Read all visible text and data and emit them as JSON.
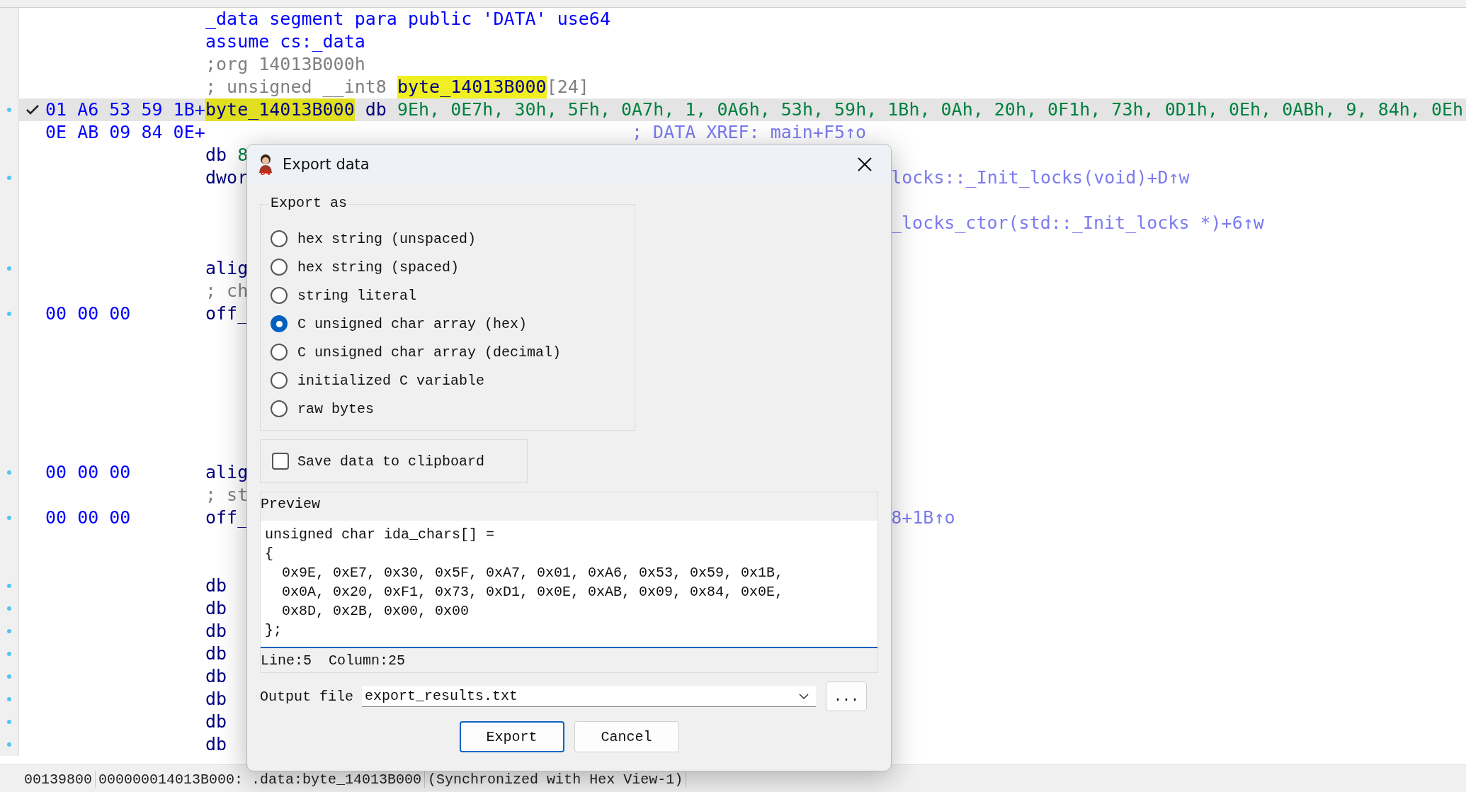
{
  "listing": {
    "rows": [
      {
        "selected": false,
        "dot": false,
        "segments": [
          {
            "kind": "keyword",
            "text": "_data segment para public 'DATA' use64"
          }
        ]
      },
      {
        "selected": false,
        "dot": false,
        "segments": [
          {
            "kind": "keyword",
            "text": "assume cs:_data"
          }
        ]
      },
      {
        "selected": false,
        "dot": false,
        "segments": [
          {
            "kind": "comment",
            "text": ";org 14013B000h"
          }
        ]
      },
      {
        "selected": false,
        "dot": false,
        "segments": [
          {
            "kind": "comment",
            "text": "; unsigned __int8 "
          },
          {
            "kind": "highlight",
            "text": "byte_14013B000"
          },
          {
            "kind": "comment",
            "text": "[24]"
          }
        ]
      },
      {
        "selected": true,
        "dot": true,
        "bytes": "01 A6 53 59 1B+",
        "segments": [
          {
            "kind": "highlight",
            "text": "byte_14013B000"
          },
          {
            "kind": "code",
            "text": " db "
          },
          {
            "kind": "number",
            "text": "9Eh, 0E7h, 30h, 5Fh, 0A7h, 1, 0A6h, 53h, 59h, 1Bh, 0Ah, 20h, 0F1h, 73h, 0D1h, 0Eh, 0ABh, 9, 84h, 0Eh"
          }
        ]
      },
      {
        "selected": false,
        "dot": false,
        "bytes": "0E AB 09 84 0E+",
        "segments": [
          {
            "kind": "xref_near",
            "text": "; DATA XREF: main+F5↑o"
          }
        ]
      },
      {
        "selected": false,
        "dot": false,
        "segments": [
          {
            "kind": "code",
            "text": "db "
          },
          {
            "kind": "number",
            "text": "8"
          }
        ]
      },
      {
        "selected": false,
        "dot": true,
        "segments": [
          {
            "kind": "code",
            "text": "dwor"
          },
          {
            "kind": "xref_tail",
            "text": "locks::_Init_locks(void)+D↑w"
          }
        ]
      },
      {
        "selected": false,
        "dot": false,
        "segments": []
      },
      {
        "selected": false,
        "dot": false,
        "segments": [
          {
            "kind": "xref_tail",
            "text": "_locks_ctor(std::_Init_locks *)+6↑w"
          }
        ]
      },
      {
        "selected": false,
        "dot": false,
        "segments": []
      },
      {
        "selected": false,
        "dot": true,
        "segments": [
          {
            "kind": "code",
            "text": "alig"
          }
        ]
      },
      {
        "selected": false,
        "dot": false,
        "segments": [
          {
            "kind": "comment",
            "text": "; ch"
          }
        ]
      },
      {
        "selected": false,
        "dot": true,
        "bytes": "00 00 00",
        "segments": [
          {
            "kind": "code",
            "text": "off_"
          }
        ]
      },
      {
        "selected": false,
        "dot": false,
        "segments": []
      },
      {
        "selected": false,
        "dot": false,
        "segments": []
      },
      {
        "selected": false,
        "dot": false,
        "segments": []
      },
      {
        "selected": false,
        "dot": false,
        "segments": []
      },
      {
        "selected": false,
        "dot": false,
        "segments": []
      },
      {
        "selected": false,
        "dot": false,
        "segments": []
      },
      {
        "selected": false,
        "dot": true,
        "bytes": "00 00 00",
        "segments": [
          {
            "kind": "code",
            "text": "alig"
          }
        ]
      },
      {
        "selected": false,
        "dot": false,
        "segments": [
          {
            "kind": "comment",
            "text": "; st"
          }
        ]
      },
      {
        "selected": false,
        "dot": true,
        "bytes": "00 00 00",
        "segments": [
          {
            "kind": "code",
            "text": "off_"
          },
          {
            "kind": "xref_tail",
            "text": "8+1B↑o"
          }
        ]
      },
      {
        "selected": false,
        "dot": false,
        "segments": []
      },
      {
        "selected": false,
        "dot": false,
        "segments": []
      },
      {
        "selected": false,
        "dot": true,
        "segments": [
          {
            "kind": "code",
            "text": "db"
          }
        ]
      },
      {
        "selected": false,
        "dot": true,
        "segments": [
          {
            "kind": "code",
            "text": "db"
          }
        ]
      },
      {
        "selected": false,
        "dot": true,
        "segments": [
          {
            "kind": "code",
            "text": "db"
          }
        ]
      },
      {
        "selected": false,
        "dot": true,
        "segments": [
          {
            "kind": "code",
            "text": "db"
          }
        ]
      },
      {
        "selected": false,
        "dot": true,
        "segments": [
          {
            "kind": "code",
            "text": "db"
          }
        ]
      },
      {
        "selected": false,
        "dot": true,
        "segments": [
          {
            "kind": "code",
            "text": "db"
          }
        ]
      },
      {
        "selected": false,
        "dot": true,
        "segments": [
          {
            "kind": "code",
            "text": "db"
          }
        ]
      },
      {
        "selected": false,
        "dot": true,
        "segments": [
          {
            "kind": "code",
            "text": "db"
          }
        ]
      }
    ]
  },
  "status_bar": [
    "00139800",
    "000000014013B000: .data:byte_14013B000",
    "(Synchronized with Hex View-1)"
  ],
  "dialog": {
    "title": "Export data",
    "icon_badge": "64",
    "export_as": {
      "label": "Export as",
      "options": [
        {
          "label": "hex string (unspaced)",
          "selected": false
        },
        {
          "label": "hex string (spaced)",
          "selected": false
        },
        {
          "label": "string literal",
          "selected": false
        },
        {
          "label": "C unsigned char array (hex)",
          "selected": true
        },
        {
          "label": "C unsigned char array (decimal)",
          "selected": false
        },
        {
          "label": "initialized C variable",
          "selected": false
        },
        {
          "label": "raw bytes",
          "selected": false
        }
      ]
    },
    "save_to_clipboard": {
      "label": "Save data to clipboard",
      "checked": false
    },
    "preview": {
      "label": "Preview",
      "lines": [
        "unsigned char ida_chars[] =",
        "{",
        "  0x9E, 0xE7, 0x30, 0x5F, 0xA7, 0x01, 0xA6, 0x53, 0x59, 0x1B,",
        "  0x0A, 0x20, 0xF1, 0x73, 0xD1, 0x0E, 0xAB, 0x09, 0x84, 0x0E,",
        "  0x8D, 0x2B, 0x00, 0x00",
        "};"
      ],
      "position": "Line:5  Column:25"
    },
    "output_file": {
      "label": "Output file",
      "value": "export_results.txt",
      "browse": "..."
    },
    "buttons": [
      {
        "label": "Export",
        "kind": "default"
      },
      {
        "label": "Cancel",
        "kind": "normal"
      }
    ]
  }
}
